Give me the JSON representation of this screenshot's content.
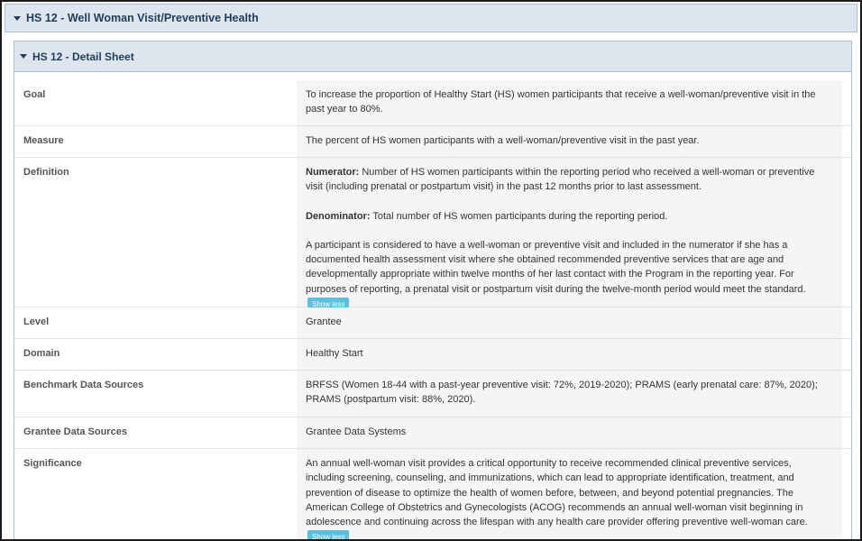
{
  "outer": {
    "title": "HS 12 - Well Woman Visit/Preventive Health"
  },
  "inner": {
    "title": "HS 12 - Detail Sheet"
  },
  "rows": {
    "goal": {
      "label": "Goal",
      "text": "To increase the proportion of Healthy Start (HS) women participants that receive a well-woman/preventive visit in the past year to 80%."
    },
    "measure": {
      "label": "Measure",
      "text": "The percent of HS women participants with a well-woman/preventive visit in the past year."
    },
    "definition": {
      "label": "Definition",
      "numerator_label": "Numerator:",
      "numerator_text": " Number of HS women participants within the reporting period who received a well-woman or preventive visit (including prenatal or postpartum visit) in the past 12 months prior to last assessment.",
      "denominator_label": "Denominator:",
      "denominator_text": " Total number of HS women participants during the reporting period.",
      "extra_text": "A participant is considered to have a well-woman or preventive visit and included in the numerator if she has a documented health assessment visit where she obtained recommended preventive services that are age and developmentally appropriate within twelve months of her last contact with the Program in the reporting year. For purposes of reporting, a prenatal visit or postpartum visit during the twelve-month period would meet the standard.",
      "toggle": "Show less"
    },
    "level": {
      "label": "Level",
      "text": "Grantee"
    },
    "domain": {
      "label": "Domain",
      "text": "Healthy Start"
    },
    "benchmark": {
      "label": "Benchmark Data Sources",
      "text": "BRFSS (Women 18-44 with a past-year preventive visit: 72%, 2019-2020); PRAMS (early prenatal care: 87%, 2020); PRAMS (postpartum visit: 88%, 2020)."
    },
    "grantee_sources": {
      "label": "Grantee Data Sources",
      "text": "Grantee Data Systems"
    },
    "significance": {
      "label": "Significance",
      "text": "An annual well-woman visit provides a critical opportunity to receive recommended clinical preventive services, including screening, counseling, and immunizations, which can lead to appropriate identification, treatment, and prevention of disease to optimize the health of women before, between, and beyond potential pregnancies. The American College of Obstetrics and Gynecologists (ACOG) recommends an annual well-woman visit beginning in adolescence and continuing across the lifespan with any health care provider offering preventive well-woman care.",
      "toggle": "Show less"
    }
  },
  "colors": {
    "header_bg": "#dde6ef",
    "header_text": "#1f3c5c",
    "button_bg": "#5bc0de",
    "value_bg": "#f4f5f7"
  }
}
